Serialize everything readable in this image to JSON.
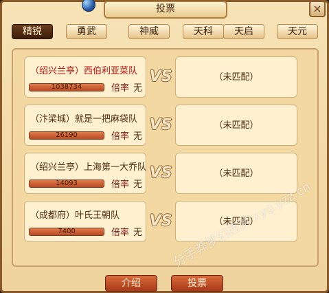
{
  "window": {
    "title": "投票",
    "close_label": "×"
  },
  "tabs": [
    {
      "label": "精锐",
      "active": true
    },
    {
      "label": "勇武",
      "active": false
    },
    {
      "label": "神威",
      "active": false
    },
    {
      "label": "天科",
      "active": false
    },
    {
      "label": "天启",
      "active": false
    },
    {
      "label": "天元",
      "active": false
    }
  ],
  "matches": [
    {
      "team": "（绍兴兰亭）西伯利亚菜队",
      "highlight": true,
      "votes": "1038734",
      "vote_fill_pct": 100,
      "rate_label": "倍率",
      "rate_value": "无",
      "vs": "VS",
      "opponent": "（未匹配）"
    },
    {
      "team": "（汴梁城）就是一把麻袋队",
      "highlight": false,
      "votes": "26190",
      "vote_fill_pct": 100,
      "rate_label": "倍率",
      "rate_value": "无",
      "vs": "VS",
      "opponent": "（未匹配）"
    },
    {
      "team": "（绍兴兰亭）上海第一大乔队",
      "highlight": false,
      "votes": "14093",
      "vote_fill_pct": 100,
      "rate_label": "倍率",
      "rate_value": "无",
      "vs": "VS",
      "opponent": "（未匹配）"
    },
    {
      "team": "（成都府）叶氏王朝队",
      "highlight": false,
      "votes": "7400",
      "vote_fill_pct": 100,
      "rate_label": "倍率",
      "rate_value": "无",
      "vs": "VS",
      "opponent": "（未匹配）"
    }
  ],
  "buttons": {
    "intro": "介绍",
    "vote": "投票"
  },
  "watermark": "分手莽梦幻西游 xyq.yzz.cn",
  "colors": {
    "active_tab": "#3b1d0a",
    "highlight_team": "#b31212",
    "button": "#b84a24"
  }
}
